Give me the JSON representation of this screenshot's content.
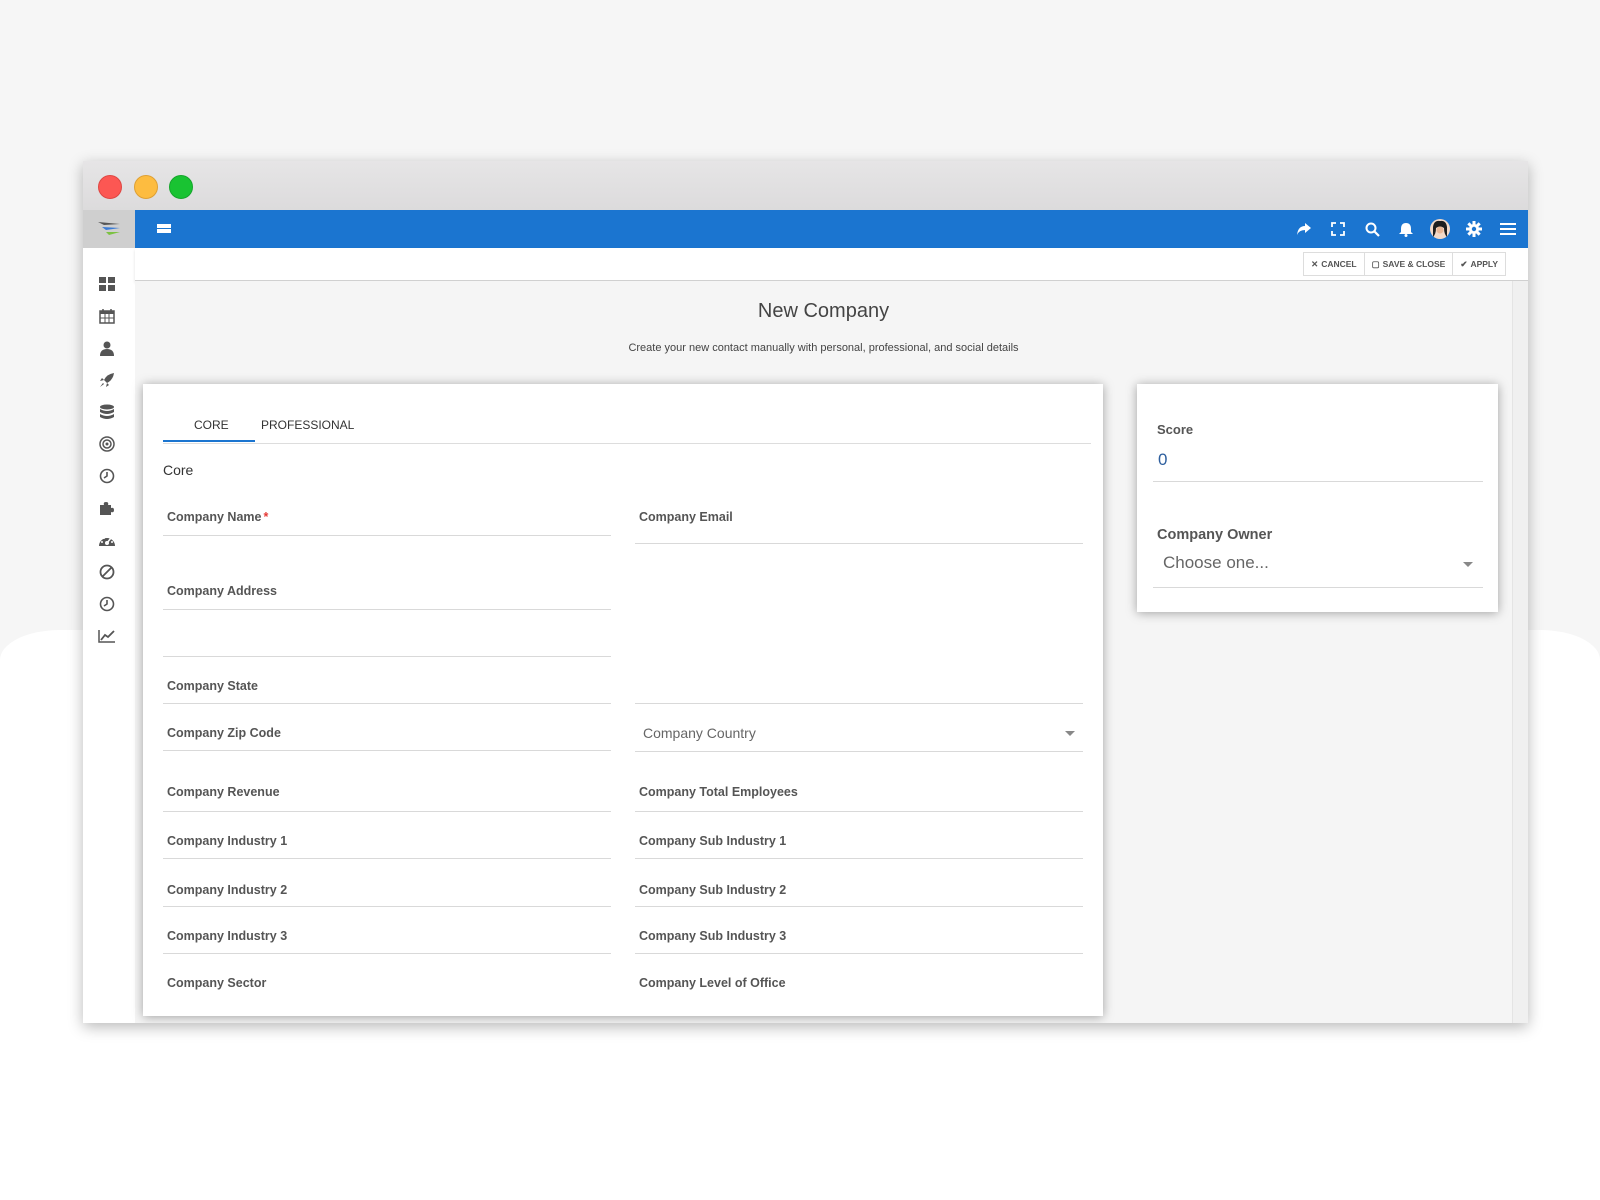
{
  "window": {
    "controls": [
      "close",
      "minimize",
      "maximize"
    ]
  },
  "sidebar": {
    "logo": "app-logo",
    "items": [
      "dashboard-icon",
      "calendar-icon",
      "person-icon",
      "rocket-icon",
      "database-icon",
      "target-icon",
      "clock-icon",
      "puzzle-icon",
      "speedometer-icon",
      "ban-icon",
      "clock-icon",
      "chart-icon"
    ]
  },
  "topbar": {
    "icons": [
      "share-icon",
      "fullscreen-icon",
      "search-icon",
      "bell-icon",
      "avatar",
      "gear-icon",
      "hamburger-icon"
    ],
    "color": "#1b75d0"
  },
  "actions": {
    "cancel": "CANCEL",
    "save_close": "SAVE & CLOSE",
    "apply": "APPLY"
  },
  "page": {
    "title": "New Company",
    "subtitle": "Create your new contact manually with personal, professional, and social details"
  },
  "tabs": {
    "core": "CORE",
    "professional": "PROFESSIONAL"
  },
  "form": {
    "section": "Core",
    "company_name": "Company Name",
    "required_mark": "*",
    "company_email": "Company Email",
    "company_address": "Company Address",
    "company_state": "Company State",
    "company_zip": "Company Zip Code",
    "company_country": "Company Country",
    "company_revenue": "Company Revenue",
    "company_total_employees": "Company Total Employees",
    "company_industry_1": "Company Industry 1",
    "company_sub_industry_1": "Company Sub Industry 1",
    "company_industry_2": "Company Industry 2",
    "company_sub_industry_2": "Company Sub Industry 2",
    "company_industry_3": "Company Industry 3",
    "company_sub_industry_3": "Company Sub Industry 3",
    "company_sector": "Company Sector",
    "company_level_of_office": "Company Level of Office"
  },
  "side": {
    "score_label": "Score",
    "score_value": "0",
    "owner_label": "Company Owner",
    "owner_placeholder": "Choose one..."
  }
}
